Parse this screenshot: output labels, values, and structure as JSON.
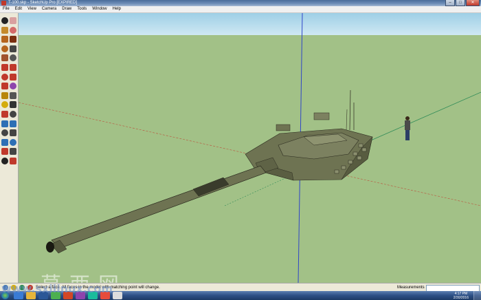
{
  "window": {
    "title": "T-100.skp - SketchUp Pro [EXPIRED]"
  },
  "window_controls": {
    "minimize": "–",
    "maximize": "□",
    "close": "✕"
  },
  "menu": [
    "File",
    "Edit",
    "View",
    "Camera",
    "Draw",
    "Tools",
    "Window",
    "Help"
  ],
  "toolbar": {
    "tools": [
      {
        "name": "select-tool-icon",
        "color": "#222222"
      },
      {
        "name": "eraser-tool-icon",
        "color": "#d9a0a0"
      },
      {
        "name": "paint-bucket-icon",
        "color": "#c48a2b"
      },
      {
        "name": "eraser-icon",
        "color": "#d46a6a"
      },
      {
        "name": "rectangle-tool-icon",
        "color": "#b5651d"
      },
      {
        "name": "line-tool-icon",
        "color": "#7a2e10"
      },
      {
        "name": "circle-tool-icon",
        "color": "#b5651d"
      },
      {
        "name": "arc-tool-icon",
        "color": "#444444"
      },
      {
        "name": "polygon-tool-icon",
        "color": "#a0522d"
      },
      {
        "name": "freehand-tool-icon",
        "color": "#555555"
      },
      {
        "name": "move-tool-icon",
        "color": "#c0392b"
      },
      {
        "name": "push-pull-tool-icon",
        "color": "#c0392b"
      },
      {
        "name": "rotate-tool-icon",
        "color": "#c0392b"
      },
      {
        "name": "follow-me-tool-icon",
        "color": "#c0392b"
      },
      {
        "name": "scale-tool-icon",
        "color": "#c0392b"
      },
      {
        "name": "offset-tool-icon",
        "color": "#8e44ad"
      },
      {
        "name": "tape-measure-icon",
        "color": "#b8860b"
      },
      {
        "name": "dimension-tool-icon",
        "color": "#555555"
      },
      {
        "name": "protractor-tool-icon",
        "color": "#d4ac0d"
      },
      {
        "name": "text-tool-icon",
        "color": "#333333"
      },
      {
        "name": "axes-tool-icon",
        "color": "#c0392b"
      },
      {
        "name": "3d-text-tool-icon",
        "color": "#444444"
      },
      {
        "name": "orbit-tool-icon",
        "color": "#2e6fb5"
      },
      {
        "name": "pan-tool-icon",
        "color": "#2e6fb5"
      },
      {
        "name": "zoom-tool-icon",
        "color": "#444444"
      },
      {
        "name": "zoom-window-icon",
        "color": "#444444"
      },
      {
        "name": "zoom-extents-icon",
        "color": "#2e6fb5"
      },
      {
        "name": "previous-view-icon",
        "color": "#2e6fb5"
      },
      {
        "name": "position-camera-icon",
        "color": "#c0392b"
      },
      {
        "name": "look-around-icon",
        "color": "#444444"
      },
      {
        "name": "walk-tool-icon",
        "color": "#222222"
      },
      {
        "name": "section-plane-icon",
        "color": "#c0392b"
      }
    ]
  },
  "status": {
    "message": "Select a face. All faces in the model with matching point will change.",
    "measurements_label": "Measurements",
    "measurements_value": ""
  },
  "taskbar": {
    "apps": [
      {
        "name": "ie-taskbar-icon",
        "color": "#3a7bd5"
      },
      {
        "name": "explorer-taskbar-icon",
        "color": "#e7b53a"
      },
      {
        "name": "word-taskbar-icon",
        "color": "#2b5797"
      },
      {
        "name": "chrome-taskbar-icon",
        "color": "#4caf50"
      },
      {
        "name": "powerpoint-taskbar-icon",
        "color": "#d24726"
      },
      {
        "name": "paint-taskbar-icon",
        "color": "#8e44ad"
      },
      {
        "name": "app-taskbar-icon",
        "color": "#1abc9c"
      },
      {
        "name": "sketchup-taskbar-icon",
        "color": "#e74c3c"
      },
      {
        "name": "search-taskbar-icon",
        "color": "#dddddd"
      }
    ],
    "clock_time": "4:17 PM",
    "clock_date": "2/30/2016"
  },
  "watermark": {
    "chinese": "莫西网",
    "url": "www.sxiiinux.com"
  },
  "colors": {
    "sky": "#b3dced",
    "ground": "#a2c187",
    "tank": "#6e7352",
    "red_axis": "#c0392b",
    "green_axis": "#2e8b57",
    "blue_axis": "#2e44c8"
  }
}
